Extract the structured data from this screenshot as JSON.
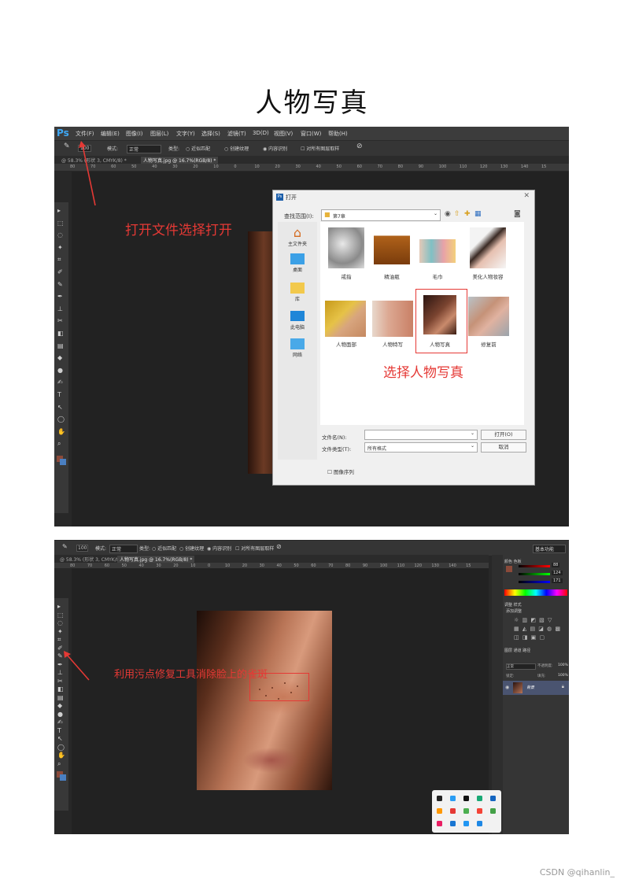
{
  "page": {
    "title": "人物写真",
    "credit": "CSDN @qihanlin_"
  },
  "ps": {
    "logo": "Ps",
    "menu": [
      "文件(F)",
      "编辑(E)",
      "图像(I)",
      "图层(L)",
      "文字(Y)",
      "选择(S)",
      "滤镜(T)",
      "3D(D)",
      "视图(V)",
      "窗口(W)",
      "帮助(H)"
    ],
    "options": {
      "size": "100",
      "mode_label": "模式:",
      "mode_value": "正常",
      "type_label": "类型:",
      "type1": "近似匹配",
      "type2": "创建纹理",
      "type3": "内容识别",
      "sample_all": "对所有图层取样"
    },
    "tabs1": [
      "@ 58.3% (形状 3, CMYK/8) *",
      "人物写真.jpg @ 16.7%(RGB/8) *"
    ],
    "tabs2": [
      "@ 58.3% (形状 3, CMYK/8) *",
      "人物写真.jpg @ 16.7%(RGB/8) *"
    ],
    "ruler": [
      "80",
      "70",
      "60",
      "50",
      "40",
      "30",
      "20",
      "10",
      "0",
      "10",
      "20",
      "30",
      "40",
      "50",
      "60",
      "70",
      "80",
      "90",
      "100",
      "110",
      "120",
      "130",
      "140",
      "15"
    ]
  },
  "dialog": {
    "title": "打开",
    "look_in_label": "查找范围(I):",
    "look_in_value": "第7章",
    "places": [
      "主文件夹",
      "桌面",
      "库",
      "此电脑",
      "网络"
    ],
    "files": [
      "戒指",
      "精油瓶",
      "毛巾",
      "美化人物妆容",
      "人物面部",
      "人物特写",
      "人物写真",
      "修复前"
    ],
    "filename_label": "文件名(N):",
    "filetype_label": "文件类型(T):",
    "filetype_value": "所有格式",
    "open_button": "打开(O)",
    "cancel_button": "取消",
    "image_sequence": "图像序列"
  },
  "annotations": {
    "open_file": "打开文件选择打开",
    "select_file": "选择人物写真",
    "spot_heal": "利用污点修复工具消除脸上的雀斑"
  },
  "panels": {
    "color_tabs": [
      "颜色",
      "色板"
    ],
    "rgb": {
      "r": "88",
      "g": "124",
      "b": "171"
    },
    "adjust_tabs": [
      "调整",
      "样式"
    ],
    "adjust_title": "添加调整",
    "layer_tabs": [
      "图层",
      "通道",
      "路径"
    ],
    "blend_mode": "正常",
    "opacity_label": "不透明度:",
    "opacity_value": "100%",
    "lock_label": "锁定:",
    "fill_label": "填充:",
    "fill_value": "100%",
    "layer_name": "背景",
    "workspace": "基本功能"
  },
  "colors": {
    "accent_red": "#e53935",
    "ps_bg": "#282828",
    "swatch_fg": "#8b4a3a",
    "swatch_bg": "#4a7fc1"
  }
}
